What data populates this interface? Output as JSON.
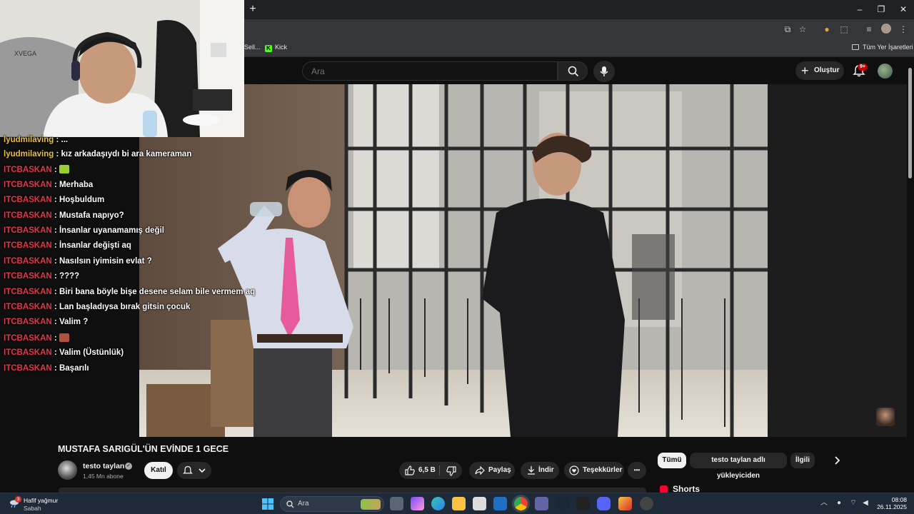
{
  "browser": {
    "new_tab": "+",
    "window_controls": [
      "–",
      "❐",
      "✕"
    ],
    "bookmarks": [
      {
        "label": "Sell..."
      },
      {
        "label": "Kick"
      }
    ],
    "all_bookmarks": "Tüm Yer İşaretleri"
  },
  "youtube": {
    "search_placeholder": "Ara",
    "create_label": "Oluştur",
    "notifications_badge": "9+",
    "video_title": "MUSTAFA SARIGÜL'ÜN EVİNDE 1 GECE",
    "channel_name": "testo taylan",
    "subscribers": "1,45 Mn abone",
    "join_label": "Katıl",
    "likes": "6,5 B",
    "share_label": "Paylaş",
    "download_label": "İndir",
    "thanks_label": "Teşekkürler",
    "more_label": "•••",
    "chips": [
      "Tümü",
      "testo taylan adlı yükleyiciden",
      "İlgili"
    ],
    "shorts_label": "Shorts"
  },
  "chat": [
    {
      "user": "lyudmilaving",
      "message": "kız arkadaşıydı bi ara kameraman",
      "color": "#e8c040"
    },
    {
      "user": "ITCBASKAN",
      "message": "",
      "emote": "#9acd32"
    },
    {
      "user": "ITCBASKAN",
      "message": "Merhaba"
    },
    {
      "user": "ITCBASKAN",
      "message": "Hoşbuldum"
    },
    {
      "user": "ITCBASKAN",
      "message": "Mustafa napıyo?"
    },
    {
      "user": "ITCBASKAN",
      "message": "İnsanlar uyanamamış değil"
    },
    {
      "user": "ITCBASKAN",
      "message": "İnsanlar değişti aq"
    },
    {
      "user": "ITCBASKAN",
      "message": "Nasılsın iyimisin evlat ?"
    },
    {
      "user": "ITCBASKAN",
      "message": "????"
    },
    {
      "user": "ITCBASKAN",
      "message": "Biri bana böyle bişe desene selam bile vermem aq"
    },
    {
      "user": "ITCBASKAN",
      "message": "Lan başladıysa bırak gitsin çocuk"
    },
    {
      "user": "ITCBASKAN",
      "message": "Valim ?"
    },
    {
      "user": "ITCBASKAN",
      "message": "",
      "emote": "#b05040"
    },
    {
      "user": "ITCBASKAN",
      "message": "Valim (Üstünlük)"
    },
    {
      "user": "ITCBASKAN",
      "message": "Başarılı"
    }
  ],
  "taskbar": {
    "weather_title": "Hafif yağmur",
    "weather_sub": "Sabah",
    "weather_badge": "3",
    "search_placeholder": "Ara",
    "time": "08:08",
    "date": "26.11.2025"
  },
  "colors": {
    "chat_user": "#e8364a",
    "accent_red": "#cc0000",
    "kick_green": "#53fc18"
  }
}
